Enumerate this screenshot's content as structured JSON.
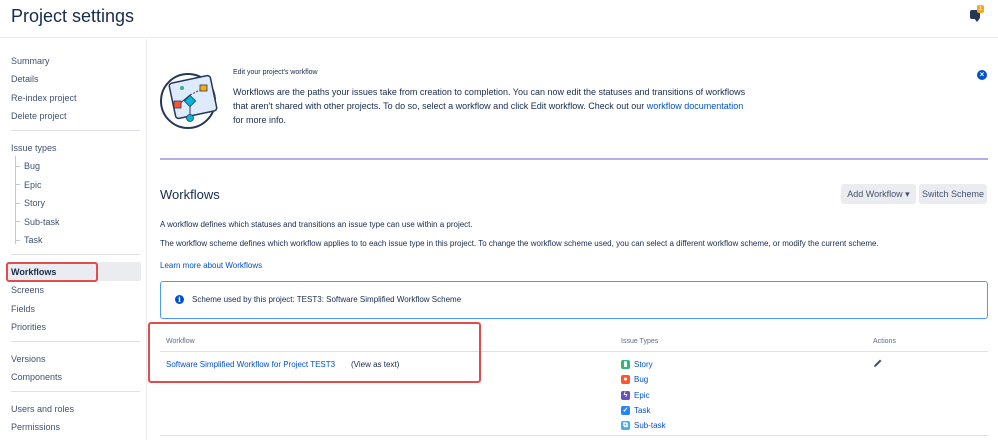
{
  "header": {
    "title": "Project settings",
    "notification_count": "1"
  },
  "sidebar": {
    "group1": [
      "Summary",
      "Details",
      "Re-index project",
      "Delete project"
    ],
    "issue_types_label": "Issue types",
    "issue_types": [
      "Bug",
      "Epic",
      "Story",
      "Sub-task",
      "Task"
    ],
    "active": "Workflows",
    "group3": [
      "Screens",
      "Fields",
      "Priorities"
    ],
    "group4": [
      "Versions",
      "Components"
    ],
    "group5": [
      "Users and roles",
      "Permissions"
    ]
  },
  "intro": {
    "heading": "Edit your project's workflow",
    "text_before_link": "Workflows are the paths your issues take from creation to completion. You can now edit the statuses and transitions of workflows that aren't shared with other projects. To do so, select a workflow and click Edit workflow. Check out our ",
    "link": "workflow documentation",
    "text_after_link": " for more info.",
    "dismiss_icon": "close-icon"
  },
  "workflows": {
    "title": "Workflows",
    "add_button": "Add Workflow",
    "switch_button": "Switch Scheme",
    "desc1": "A workflow defines which statuses and transitions an issue type can use within a project.",
    "desc2": "The workflow scheme defines which workflow applies to to each issue type in this project. To change the workflow scheme used, you can select a different workflow scheme, or modify the current scheme.",
    "learn_more": "Learn more about Workflows",
    "scheme_info": "Scheme used by this project: TEST3: Software Simplified Workflow Scheme"
  },
  "table": {
    "headers": [
      "Workflow",
      "Issue Types",
      "Actions"
    ],
    "workflow_name": "Software Simplified Workflow for Project TEST3",
    "view_as_text": "(View as text)",
    "issue_types": [
      {
        "label": "Story",
        "color": "#36b37e",
        "icon": "story-icon"
      },
      {
        "label": "Bug",
        "color": "#ff5630",
        "icon": "bug-icon"
      },
      {
        "label": "Epic",
        "color": "#6554c0",
        "icon": "epic-icon"
      },
      {
        "label": "Task",
        "color": "#2684ff",
        "icon": "task-icon"
      },
      {
        "label": "Sub-task",
        "color": "#4bade8",
        "icon": "subtask-icon"
      }
    ]
  },
  "colors": {
    "link": "#0052cc",
    "highlight": "#e34c4c",
    "active_bg": "#ebecf0"
  }
}
